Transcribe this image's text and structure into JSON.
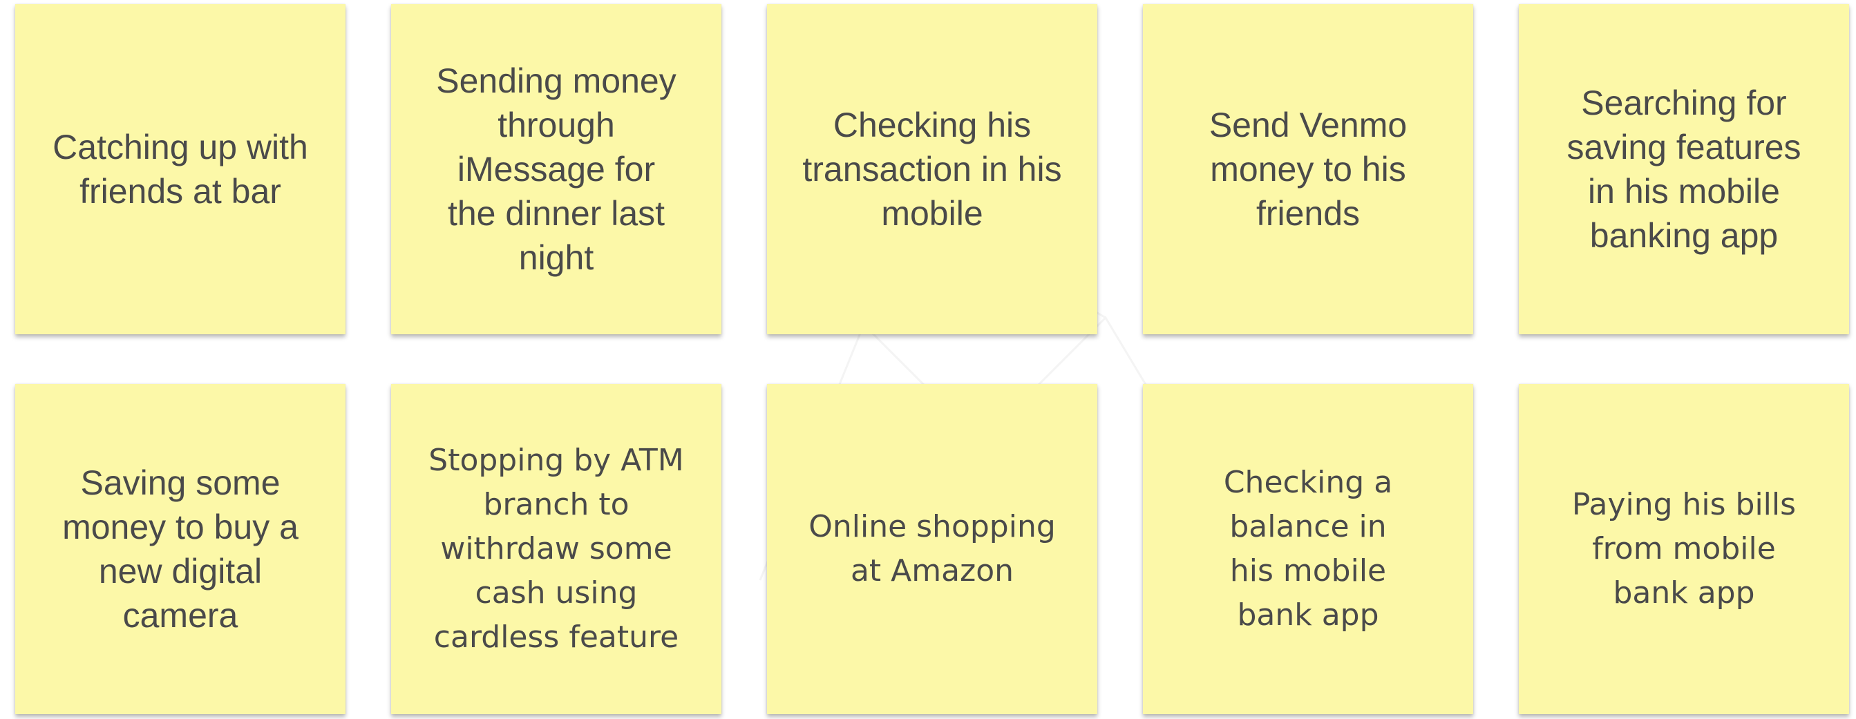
{
  "notes": [
    {
      "text": "Catching up with\nfriends at bar"
    },
    {
      "text": "Sending money\nthrough\niMessage for\nthe dinner last\nnight"
    },
    {
      "text": "Checking his\ntransaction in his\nmobile"
    },
    {
      "text": "Send Venmo\nmoney to his\nfriends"
    },
    {
      "text": "Searching for\nsaving features\nin his mobile\nbanking app"
    },
    {
      "text": "Saving some\nmoney to buy a\nnew digital\ncamera"
    },
    {
      "text": "Stopping by ATM\nbranch to\nwithrdaw some\ncash using\ncardless feature"
    },
    {
      "text": "Online shopping\nat Amazon"
    },
    {
      "text": "Checking a\nbalance in\nhis mobile\nbank app"
    },
    {
      "text": "Paying his bills\nfrom mobile\nbank app"
    }
  ],
  "colors": {
    "note_fill": "#fcf8a8",
    "note_text": "#4a4a4a",
    "background": "#ffffff"
  }
}
